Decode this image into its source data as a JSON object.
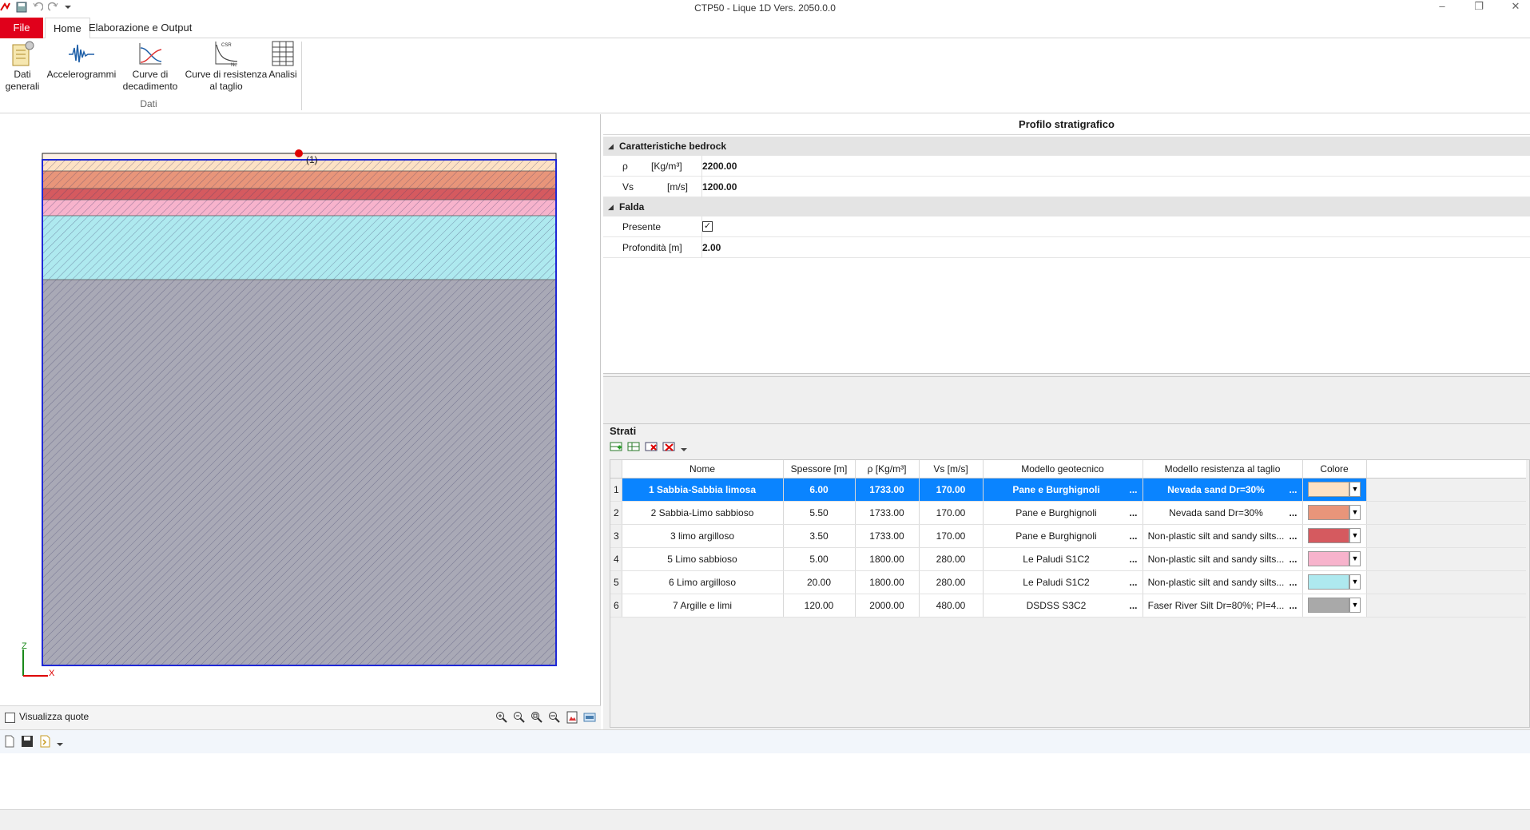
{
  "window": {
    "title": "CTP50 - Lique 1D Vers. 2050.0.0"
  },
  "ribbon": {
    "tabs": [
      "File",
      "Home",
      "Elaborazione e Output"
    ],
    "buttons": [
      {
        "label1": "Dati",
        "label2": "generali"
      },
      {
        "label1": "Accelerogrammi",
        "label2": ""
      },
      {
        "label1": "Curve di",
        "label2": "decadimento"
      },
      {
        "label1": "Curve di resistenza",
        "label2": "al taglio"
      },
      {
        "label1": "Analisi",
        "label2": ""
      }
    ],
    "group_label": "Dati",
    "icons": {
      "csr_label": "CSR",
      "nc_label": "Nc"
    }
  },
  "drawing": {
    "marker_label": "(1)",
    "axis_z": "Z",
    "axis_x": "X"
  },
  "left_footer": {
    "show_quotes_label": "Visualizza quote"
  },
  "panel": {
    "title": "Profilo stratigrafico",
    "bedrock": {
      "category": "Caratteristiche bedrock",
      "rho_name": "ρ",
      "rho_unit": "[Kg/m³]",
      "rho_value": "2200.00",
      "vs_name": "Vs",
      "vs_unit": "[m/s]",
      "vs_value": "1200.00"
    },
    "falda": {
      "category": "Falda",
      "presente_label": "Presente",
      "presente_checked": true,
      "profondita_label": "Profondità [m]",
      "profondita_value": "2.00"
    }
  },
  "strati": {
    "title": "Strati",
    "columns": [
      "Nome",
      "Spessore [m]",
      "ρ [Kg/m³]",
      "Vs [m/s]",
      "Modello geotecnico",
      "Modello resistenza al taglio",
      "Colore"
    ],
    "rows": [
      {
        "n": "1",
        "nome": "1 Sabbia-Sabbia limosa",
        "spessore": "6.00",
        "rho": "1733.00",
        "vs": "170.00",
        "geo": "Pane e Burghignoli",
        "res": "Nevada sand Dr=30%",
        "color": "#fde1c4"
      },
      {
        "n": "2",
        "nome": "2 Sabbia-Limo sabbioso",
        "spessore": "5.50",
        "rho": "1733.00",
        "vs": "170.00",
        "geo": "Pane e Burghignoli",
        "res": "Nevada sand Dr=30%",
        "color": "#e8957a"
      },
      {
        "n": "3",
        "nome": "3 limo argilloso",
        "spessore": "3.50",
        "rho": "1733.00",
        "vs": "170.00",
        "geo": "Pane e Burghignoli",
        "res": "Non-plastic silt and sandy silts...",
        "color": "#d55a5f"
      },
      {
        "n": "4",
        "nome": "5 Limo sabbioso",
        "spessore": "5.00",
        "rho": "1800.00",
        "vs": "280.00",
        "geo": "Le Paludi S1C2",
        "res": "Non-plastic silt and sandy silts...",
        "color": "#f7b3cc"
      },
      {
        "n": "5",
        "nome": "6 Limo argilloso",
        "spessore": "20.00",
        "rho": "1800.00",
        "vs": "280.00",
        "geo": "Le Paludi S1C2",
        "res": "Non-plastic silt and sandy silts...",
        "color": "#aee9ef"
      },
      {
        "n": "6",
        "nome": "7 Argille e limi",
        "spessore": "120.00",
        "rho": "2000.00",
        "vs": "480.00",
        "geo": "DSDSS S3C2",
        "res": "Faser River Silt Dr=80%; PI=4...",
        "color": "#a9a9a9"
      }
    ],
    "selected_row": 0,
    "ellipsis": "..."
  }
}
